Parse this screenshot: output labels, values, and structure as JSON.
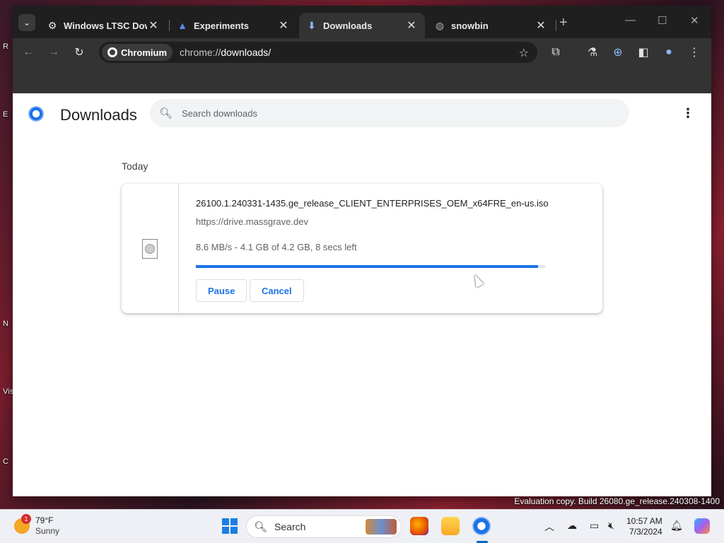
{
  "desktop": {
    "labels": [
      "R",
      "E",
      "N",
      "Vis",
      "C"
    ],
    "watermark": "Evaluation copy. Build 26080.ge_release.240308-1400"
  },
  "browser": {
    "tabs": [
      {
        "title": "Windows LTSC Dow",
        "icon": "gear-icon",
        "active": false
      },
      {
        "title": "Experiments",
        "icon": "flask-icon",
        "active": false
      },
      {
        "title": "Downloads",
        "icon": "download-icon",
        "active": true
      },
      {
        "title": "snowbin",
        "icon": "globe-icon",
        "active": false
      }
    ],
    "omnibox": {
      "chip_label": "Chromium",
      "url_scheme": "chrome://",
      "url_path": "downloads/"
    }
  },
  "downloads_page": {
    "title": "Downloads",
    "search_placeholder": "Search downloads",
    "date_header": "Today",
    "item": {
      "file_name": "26100.1.240331-1435.ge_release_CLIENT_ENTERPRISES_OEM_x64FRE_en-us.iso",
      "source_url": "https://drive.massgrave.dev",
      "status": "8.6 MB/s - 4.1 GB of 4.2 GB, 8 secs left",
      "progress_fraction": 0.98,
      "pause_label": "Pause",
      "cancel_label": "Cancel"
    }
  },
  "taskbar": {
    "weather_temp": "79°F",
    "weather_condition": "Sunny",
    "weather_badge": "1",
    "search_label": "Search",
    "time": "10:57 AM",
    "date": "7/3/2024"
  },
  "colors": {
    "accent": "#1a73e8",
    "tabstrip": "#1f1f1f",
    "toolbar": "#333333"
  }
}
